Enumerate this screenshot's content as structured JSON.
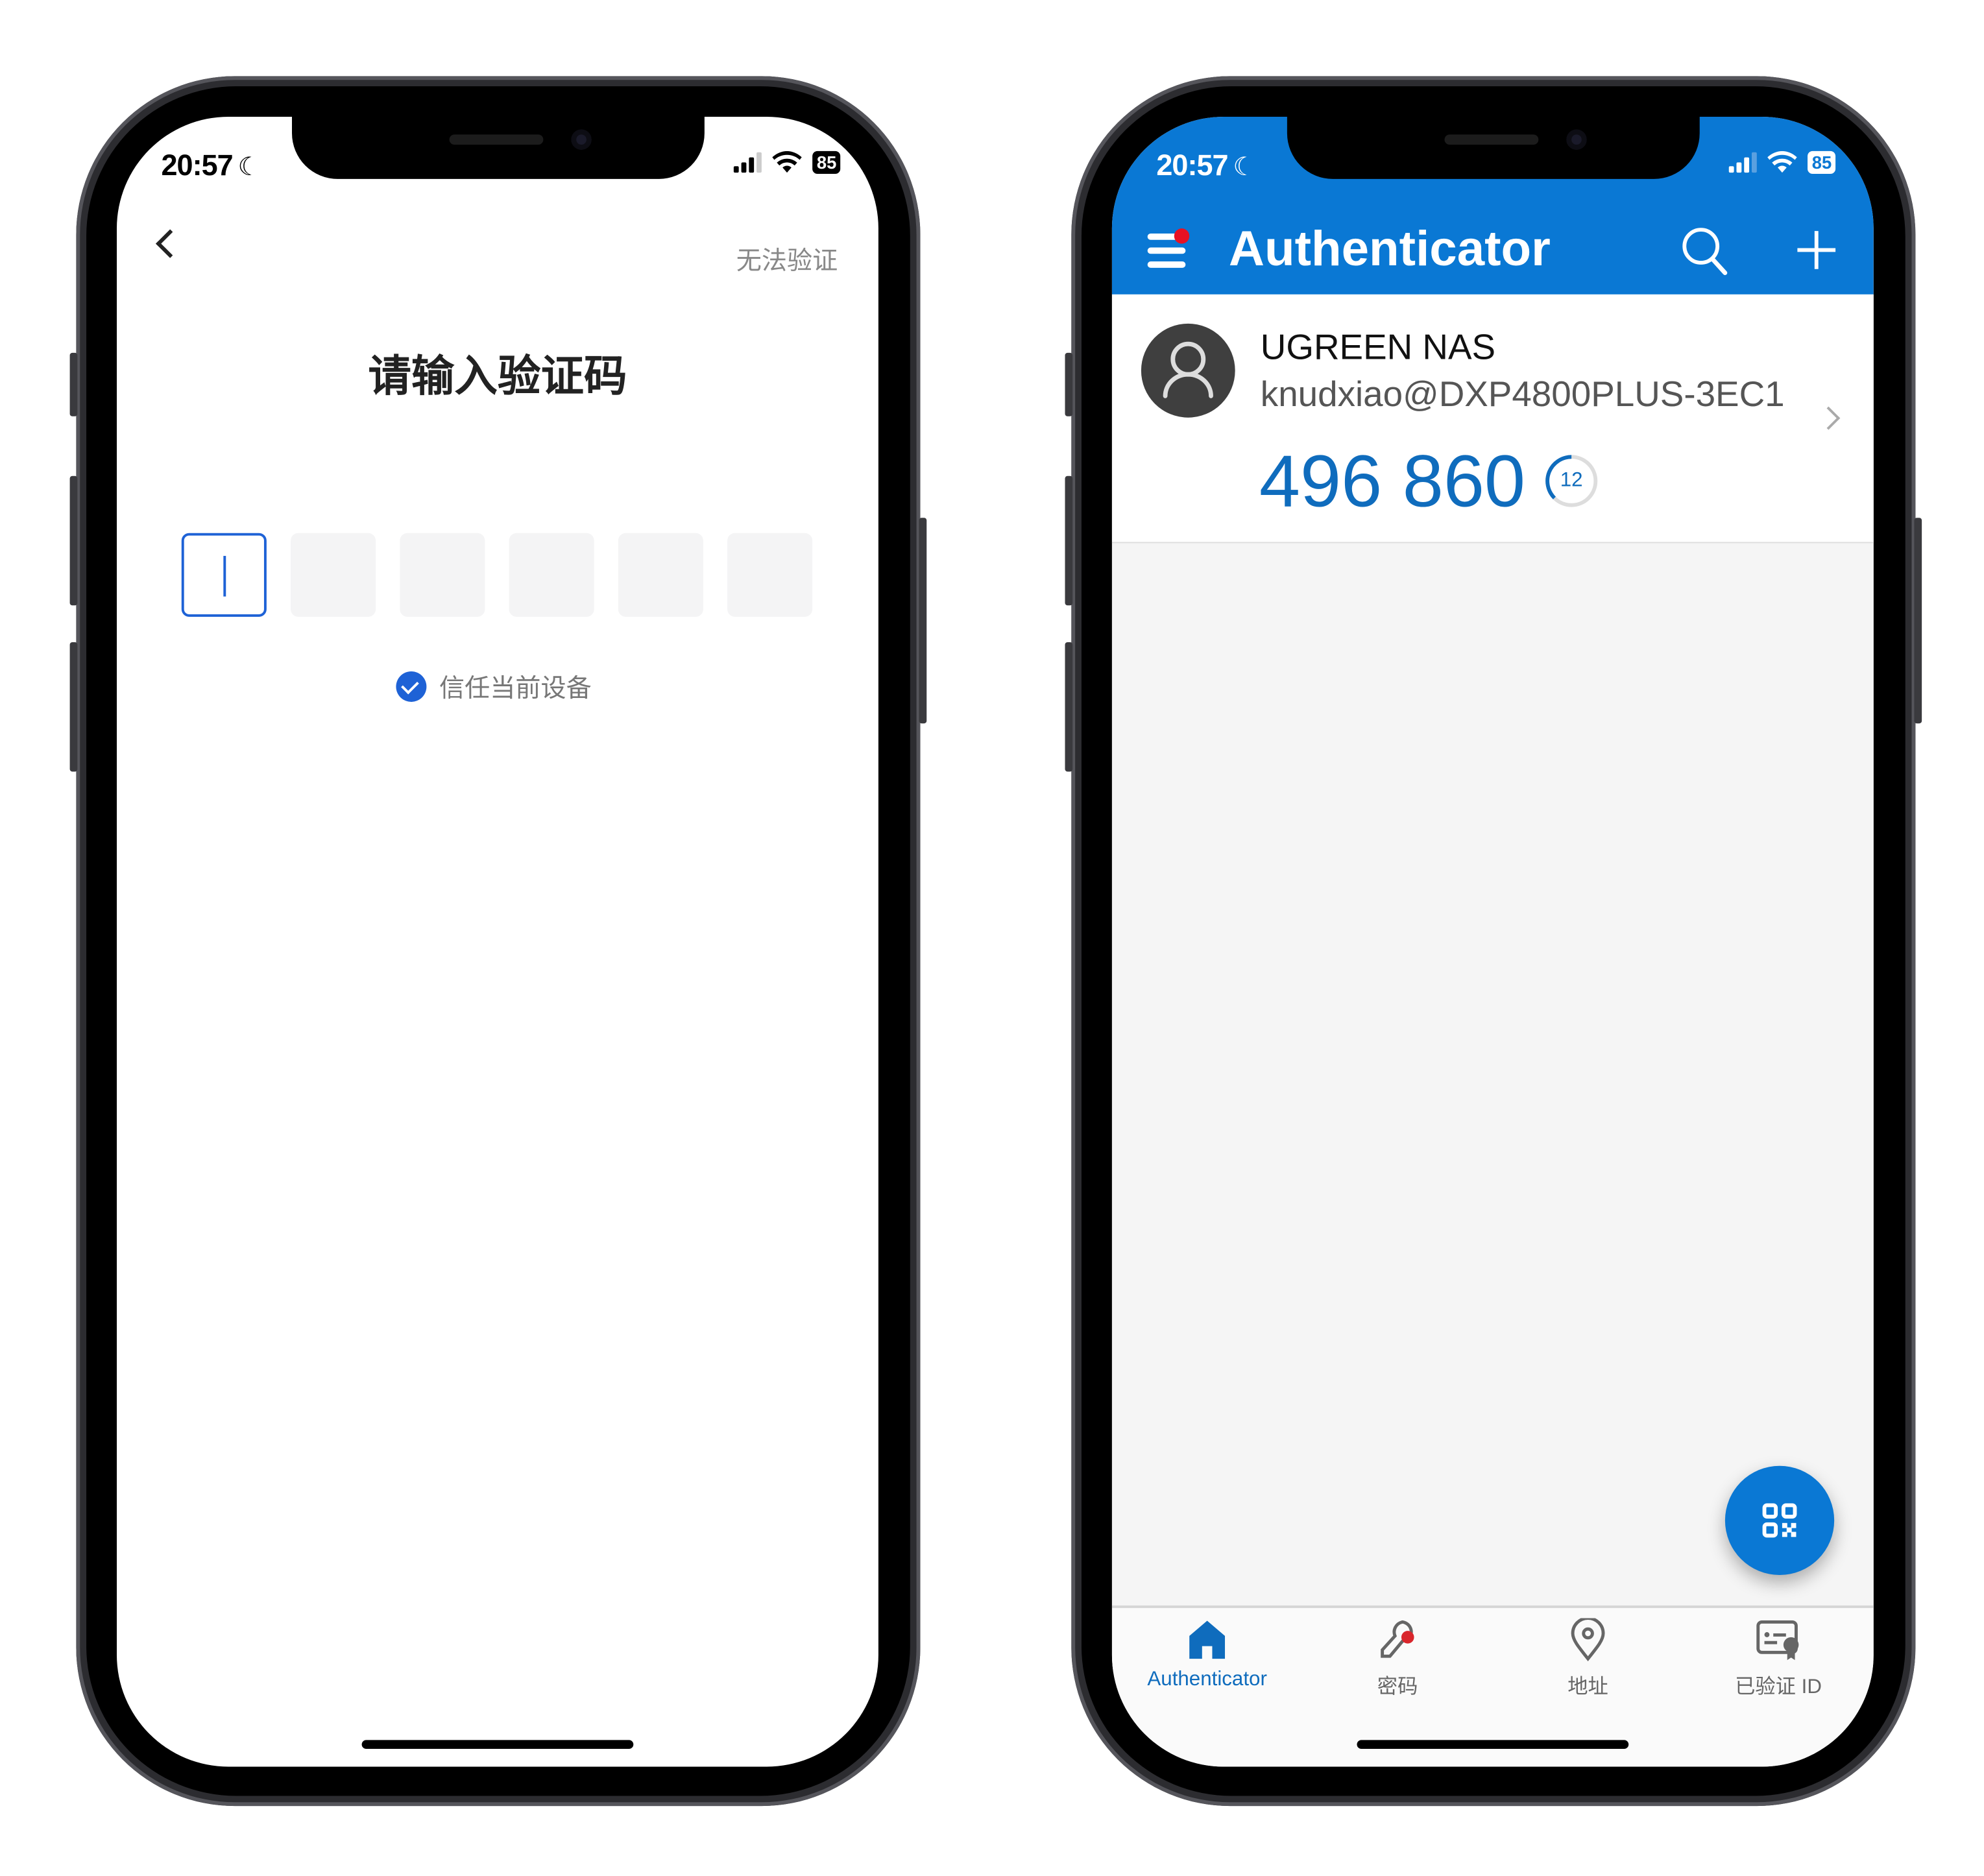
{
  "status_bar": {
    "time": "20:57",
    "battery": "85"
  },
  "left_phone": {
    "cant_verify": "无法验证",
    "title": "请输入验证码",
    "code_boxes": [
      "",
      "",
      "",
      "",
      "",
      ""
    ],
    "trust_device": {
      "label": "信任当前设备",
      "checked": true
    }
  },
  "right_phone": {
    "app_title": "Authenticator",
    "accent_color": "#0a78d4",
    "account": {
      "name": "UGREEN NAS",
      "user": "knudxiao@DXP4800PLUS-3EC1",
      "code": "496 860",
      "seconds_left": "12"
    },
    "tabs": [
      {
        "label": "Authenticator",
        "icon": "home-icon",
        "active": true
      },
      {
        "label": "密码",
        "icon": "key-icon",
        "active": false
      },
      {
        "label": "地址",
        "icon": "location-pin-icon",
        "active": false
      },
      {
        "label": "已验证 ID",
        "icon": "id-card-icon",
        "active": false
      }
    ]
  }
}
